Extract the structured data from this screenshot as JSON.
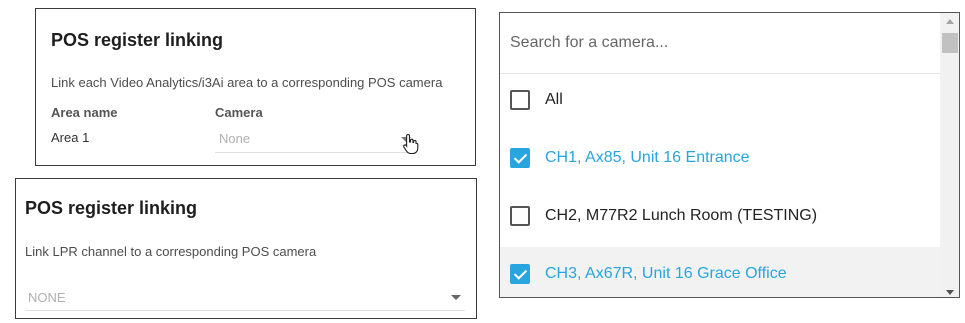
{
  "area_linking": {
    "title": "POS register linking",
    "description": "Link each Video Analytics/i3Ai area to a corresponding POS camera",
    "columns": [
      "Area name",
      "Camera"
    ],
    "rows": [
      {
        "area": "Area 1",
        "camera": "None"
      }
    ]
  },
  "lpr_linking": {
    "title": "POS register linking",
    "description": "Link LPR channel to a corresponding POS camera",
    "camera_value": "NONE"
  },
  "camera_dropdown": {
    "search_placeholder": "Search for a camera...",
    "options": [
      {
        "label": "All",
        "checked": false
      },
      {
        "label": "CH1, Ax85, Unit 16 Entrance",
        "checked": true
      },
      {
        "label": "CH2, M77R2 Lunch Room (TESTING)",
        "checked": false
      },
      {
        "label": "CH3, Ax67R, Unit 16 Grace Office",
        "checked": true
      }
    ]
  },
  "colors": {
    "accent": "#28a5de",
    "border": "#3a3a3a"
  },
  "icons": [
    "hand-pointer-icon",
    "chevron-down-icon",
    "checkbox-icon",
    "scroll-arrow-icon"
  ]
}
